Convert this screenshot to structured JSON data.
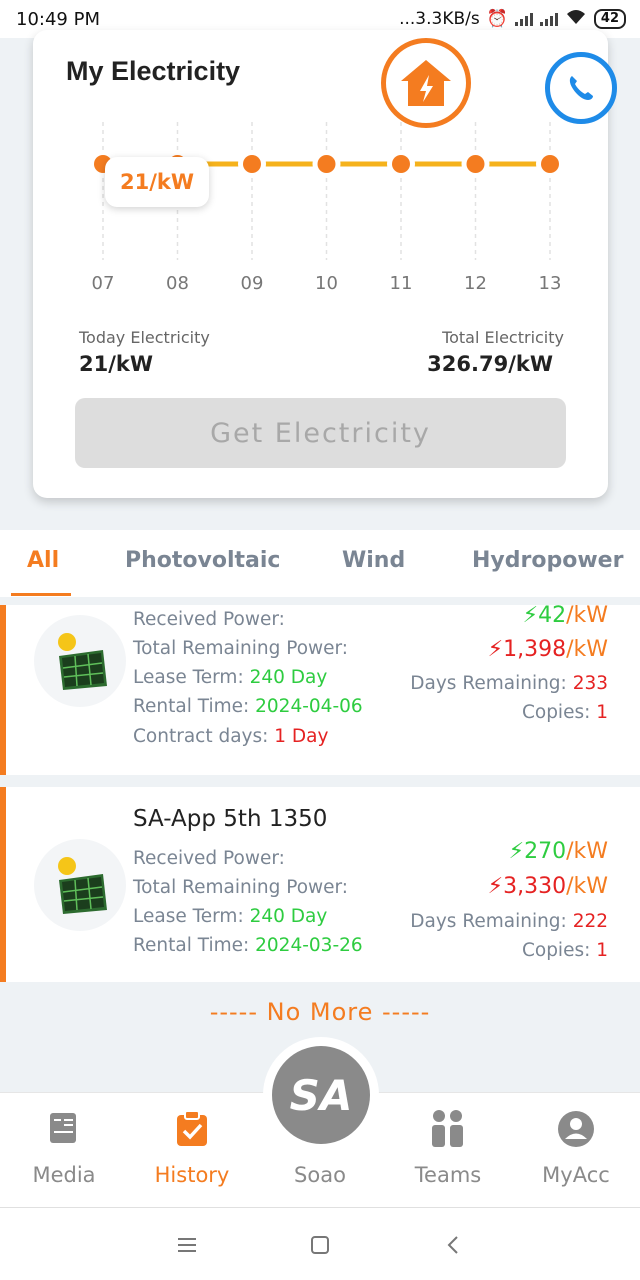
{
  "status_bar": {
    "time": "10:49 PM",
    "net_speed": "...3.3KB/s",
    "battery": "42"
  },
  "card": {
    "title": "My Electricity",
    "tooltip": "21/kW",
    "chart_data": {
      "type": "line",
      "categories": [
        "07",
        "08",
        "09",
        "10",
        "11",
        "12",
        "13"
      ],
      "series": [
        {
          "values": [
            0,
            21,
            0,
            0,
            0,
            0,
            0
          ]
        }
      ],
      "colors": {
        "line": "#f5b21c",
        "point": "#f47c20"
      }
    },
    "today_label": "Today Electricity",
    "today_value": "21/kW",
    "total_label": "Total Electricity",
    "total_value": "326.79/kW",
    "get_button": "Get Electricity"
  },
  "tabs": [
    {
      "label": "All",
      "active": true
    },
    {
      "label": "Photovoltaic",
      "active": false
    },
    {
      "label": "Wind",
      "active": false
    },
    {
      "label": "Hydropower",
      "active": false
    }
  ],
  "items": [
    {
      "name": "",
      "received_label": "Received Power:",
      "remaining_label": "Total Remaining Power:",
      "lease_label": "Lease Term:",
      "lease_value": "240 Day",
      "rental_label": "Rental Time:",
      "rental_value": "2024-04-06",
      "contract_label": "Contract days:",
      "contract_value": "1 Day",
      "received_value": "42",
      "remaining_value": "1,398",
      "unit": "/kW",
      "days_label": "Days Remaining:",
      "days_value": "233",
      "copies_label": "Copies:",
      "copies_value": "1"
    },
    {
      "name": "SA-App 5th 1350",
      "received_label": "Received Power:",
      "remaining_label": "Total Remaining Power:",
      "lease_label": "Lease Term:",
      "lease_value": "240 Day",
      "rental_label": "Rental Time:",
      "rental_value": "2024-03-26",
      "received_value": "270",
      "remaining_value": "3,330",
      "unit": "/kW",
      "days_label": "Days Remaining:",
      "days_value": "222",
      "copies_label": "Copies:",
      "copies_value": "1"
    }
  ],
  "no_more": "----- No More -----",
  "bottom_nav": [
    {
      "label": "Media",
      "icon": "media-icon"
    },
    {
      "label": "History",
      "icon": "clipboard-check-icon",
      "active": true
    },
    {
      "label": "Soao",
      "icon": "sa-logo-icon"
    },
    {
      "label": "Teams",
      "icon": "teams-icon"
    },
    {
      "label": "MyAcc",
      "icon": "account-icon"
    }
  ],
  "center_logo": "SA"
}
